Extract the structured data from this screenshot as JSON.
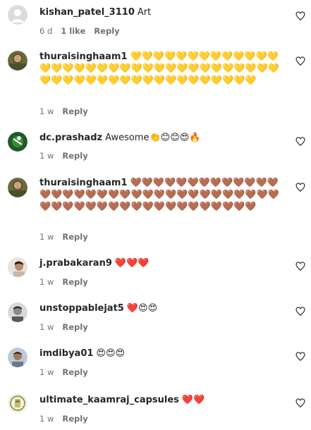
{
  "comments": [
    {
      "username": "kishan_patel_3110",
      "text": "Art",
      "time": "6 d",
      "likes": "1 like",
      "reply": "Reply",
      "avatar": "default-avatar"
    },
    {
      "username": "thuraisinghaam1",
      "text": "💛💛💛💛💛💛💛💛💛💛💛💛💛💛💛💛💛💛💛💛💛💛💛💛💛💛💛💛💛💛💛💛💛💛💛💛💛💛💛💛💛💛💛💛💛💛💛💛💛💛💛💛💛",
      "time": "1 w",
      "reply": "Reply",
      "avatar": "photo-avatar"
    },
    {
      "username": "dc.prashadz",
      "text": "Awesome👏😊😊😍🔥",
      "time": "1 w",
      "reply": "Reply",
      "avatar": "photo-avatar"
    },
    {
      "username": "thuraisinghaam1",
      "text": "🤎🤎🤎🤎🤎🤎🤎🤎🤎🤎🤎🤎🤎🤎🤎🤎🤎🤎🤎🤎🤎🤎🤎🤎🤎🤎🤎🤎🤎🤎🤎🤎🤎🤎🤎🤎🤎🤎🤎🤎🤎🤎🤎🤎🤎🤎🤎🤎🤎🤎🤎🤎🤎",
      "time": "1 w",
      "reply": "Reply",
      "avatar": "photo-avatar"
    },
    {
      "username": "j.prabakaran9",
      "text": "❤️❤️❤️",
      "time": "1 w",
      "reply": "Reply",
      "avatar": "photo-avatar"
    },
    {
      "username": "unstoppablejat5",
      "text": "❤️😍😍",
      "time": "1 w",
      "reply": "Reply",
      "avatar": "photo-avatar"
    },
    {
      "username": "imdibya01",
      "text": "😍😍😍",
      "time": "1 w",
      "reply": "Reply",
      "avatar": "photo-avatar"
    },
    {
      "username": "ultimate_kaamraj_capsules",
      "text": "❤️❤️",
      "time": "1 w",
      "reply": "Reply",
      "avatar": "logo-avatar"
    }
  ],
  "icons": {
    "like": "heart-outline-icon"
  },
  "colors": {
    "text": "#262626",
    "meta": "#737373",
    "background": "#ffffff"
  }
}
